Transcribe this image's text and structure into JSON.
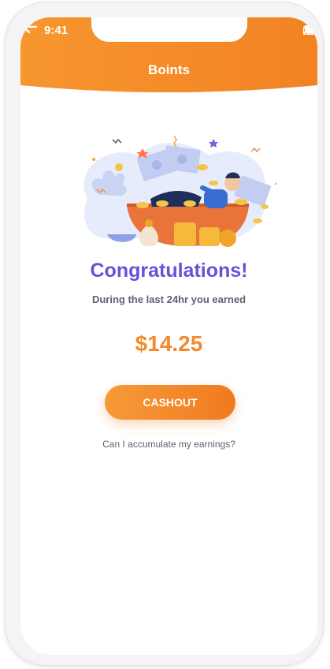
{
  "status_bar": {
    "time": "9:41"
  },
  "header": {
    "title": "Boints"
  },
  "main": {
    "congrats": "Congratulations!",
    "subtitle": "During the last 24hr you earned",
    "amount": "$14.25",
    "cashout_label": "CASHOUT",
    "help_link": "Can I accumulate my earnings?"
  },
  "colors": {
    "primary": "#f28a2a",
    "accent": "#6c4fd8"
  }
}
